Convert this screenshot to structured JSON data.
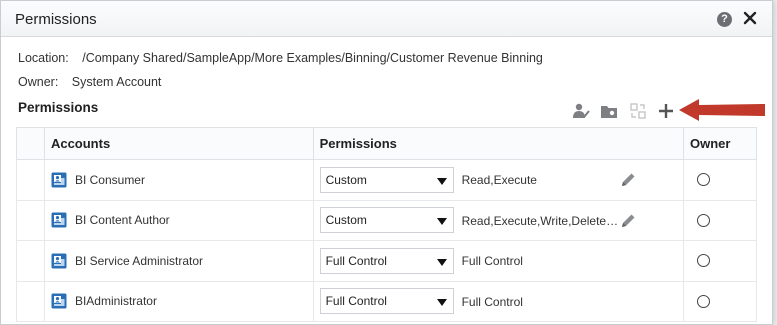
{
  "dialog": {
    "title": "Permissions",
    "help_icon": "help-icon",
    "close_icon": "close-icon"
  },
  "info": {
    "location_label": "Location:",
    "location_value": "/Company Shared/SampleApp/More Examples/Binning/Customer Revenue Binning",
    "owner_label": "Owner:",
    "owner_value": "System Account"
  },
  "section": {
    "title": "Permissions",
    "toolbar_icons": [
      "set-owner-icon",
      "apply-folder-icon",
      "replace-icon",
      "add-icon"
    ]
  },
  "table": {
    "headers": [
      "Accounts",
      "Permissions",
      "Owner"
    ],
    "rows": [
      {
        "account": "BI Consumer",
        "permission": "Custom",
        "detail": "Read,Execute",
        "editable": true
      },
      {
        "account": "BI Content Author",
        "permission": "Custom",
        "detail": "Read,Execute,Write,Delete…",
        "editable": true
      },
      {
        "account": "BI Service Administrator",
        "permission": "Full Control",
        "detail": "Full Control",
        "editable": false
      },
      {
        "account": "BIAdministrator",
        "permission": "Full Control",
        "detail": "Full Control",
        "editable": false
      }
    ]
  },
  "colors": {
    "annotation_arrow": "#c0392b",
    "account_icon": "#2a6fb5"
  }
}
